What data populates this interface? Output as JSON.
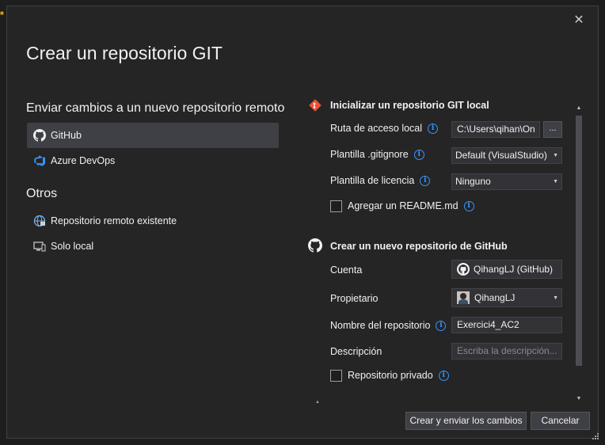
{
  "dialog": {
    "title": "Crear un repositorio GIT",
    "close_glyph": "✕"
  },
  "left": {
    "heading_push": "Enviar cambios a un nuevo repositorio remoto",
    "items_push": [
      {
        "label": "GitHub",
        "icon": "github-icon",
        "selected": true
      },
      {
        "label": "Azure DevOps",
        "icon": "azure-devops-icon",
        "selected": false
      }
    ],
    "heading_others": "Otros",
    "items_others": [
      {
        "label": "Repositorio remoto existente",
        "icon": "globe-remote-icon"
      },
      {
        "label": "Solo local",
        "icon": "local-computer-icon"
      }
    ]
  },
  "local_repo": {
    "title": "Inicializar un repositorio GIT local",
    "icon": "git-icon",
    "path_label": "Ruta de acceso local",
    "path_value": "C:\\Users\\qihan\\On",
    "browse_label": "...",
    "gitignore_label": "Plantilla .gitignore",
    "gitignore_value": "Default (VisualStudio)",
    "license_label": "Plantilla de licencia",
    "license_value": "Ninguno",
    "readme_label": "Agregar un README.md",
    "readme_checked": false
  },
  "github_repo": {
    "title": "Crear un nuevo repositorio de GitHub",
    "icon": "github-icon",
    "account_label": "Cuenta",
    "account_value": "QihangLJ (GitHub)",
    "owner_label": "Propietario",
    "owner_value": "QihangLJ",
    "name_label": "Nombre del repositorio",
    "name_value": "Exercici4_AC2",
    "description_label": "Descripción",
    "description_placeholder": "Escriba la descripción...",
    "private_label": "Repositorio privado",
    "private_checked": false
  },
  "buttons": {
    "create_push": "Crear y enviar los cambios",
    "cancel": "Cancelar"
  },
  "colors": {
    "background": "#252526",
    "selected_item": "#3f3f46",
    "info_accent": "#3794ff",
    "git_accent": "#f05133"
  }
}
